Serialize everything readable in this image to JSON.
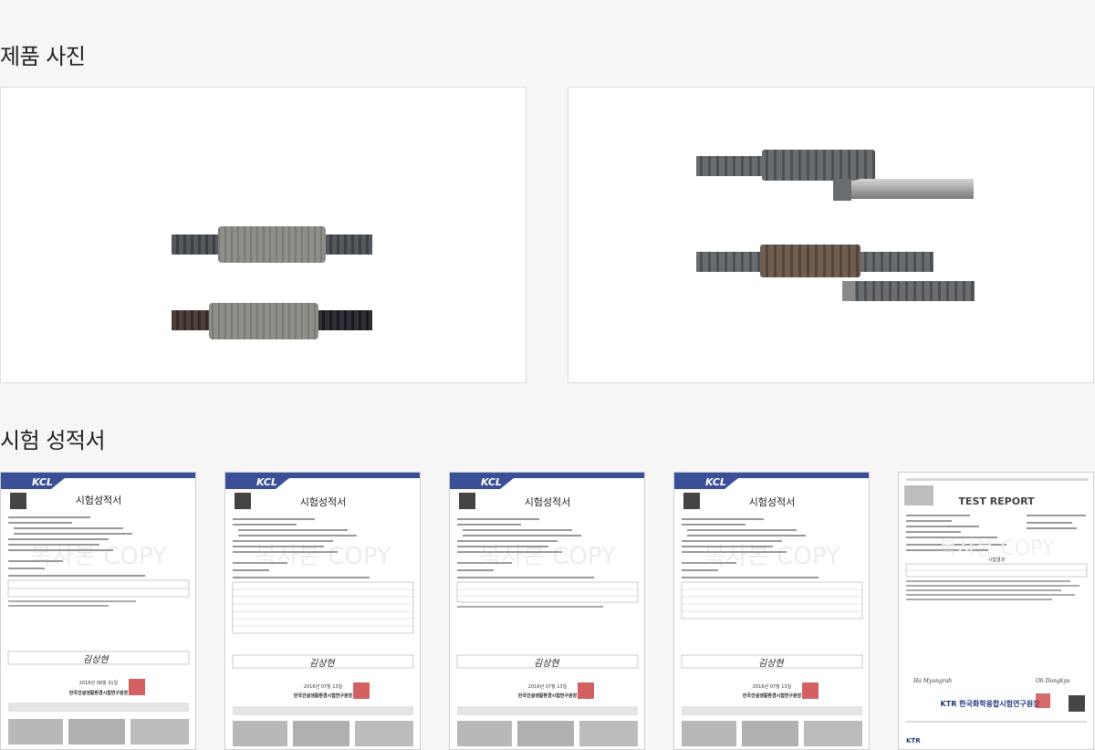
{
  "sections": {
    "product_photos_title": "제품 사진",
    "test_reports_title": "시험 성적서"
  },
  "certificates": [
    {
      "header_logo": "KCL",
      "title": "시험성적서",
      "watermark": "복사본 COPY",
      "date": "2016년 08월 31일",
      "org": "한국건설생활환경시험연구원장"
    },
    {
      "header_logo": "KCL",
      "title": "시험성적서",
      "watermark": "복사본 COPY",
      "date": "2016년 07월 13일",
      "org": "한국건설생활환경시험연구원장"
    },
    {
      "header_logo": "KCL",
      "title": "시험성적서",
      "watermark": "복사본 COPY",
      "date": "2016년 07월 13일",
      "org": "한국건설생활환경시험연구원장"
    },
    {
      "header_logo": "KCL",
      "title": "시험성적서",
      "watermark": "복사본 COPY",
      "date": "2016년 07월 13일",
      "org": "한국건설생활환경시험연구원장"
    },
    {
      "header_logo": "KTR",
      "title": "TEST REPORT",
      "subtitle": "시험결과",
      "watermark": "복사본 COPY",
      "org": "KTR 한국화학융합시험연구원장"
    }
  ],
  "colors": {
    "page_bg": "#f6f6f6",
    "kcl_header": "#3b4f97",
    "stamp_red": "#c8393b"
  }
}
